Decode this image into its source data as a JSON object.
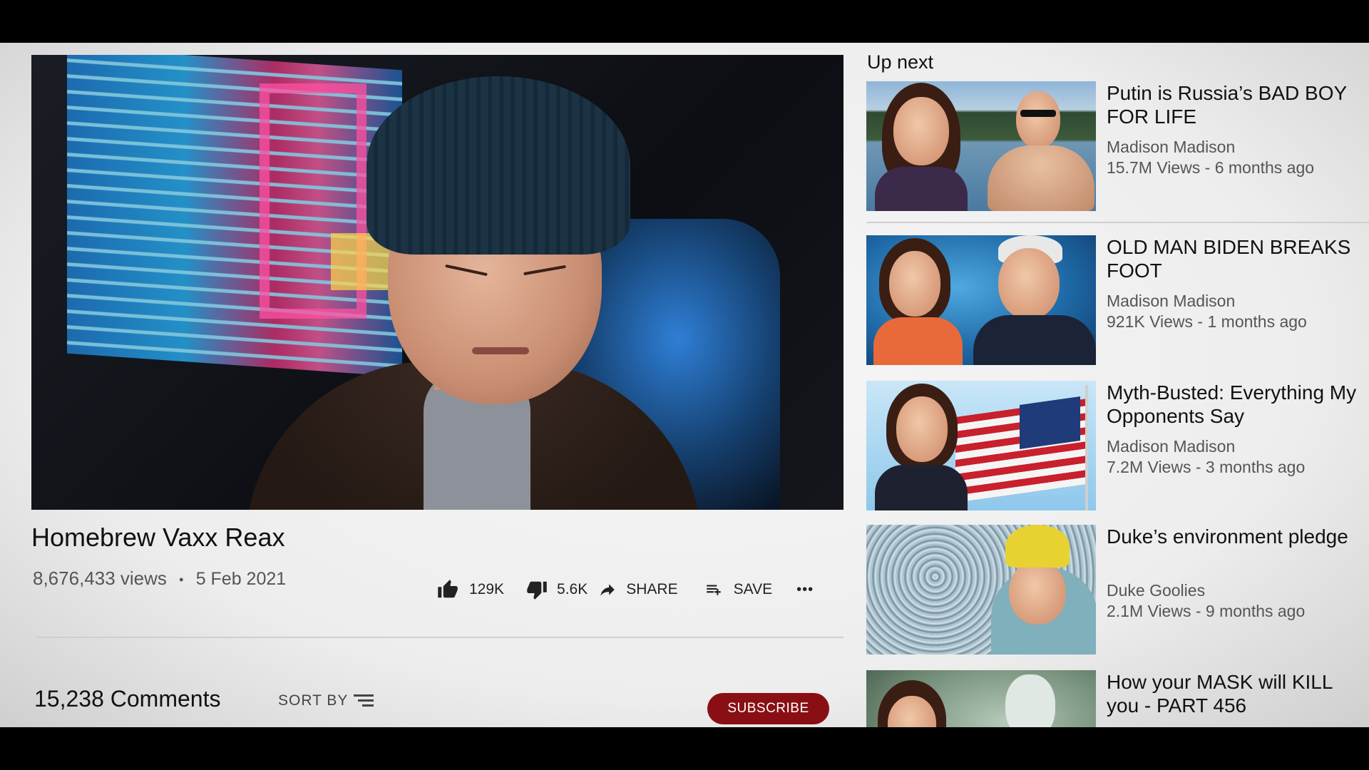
{
  "video": {
    "title": "Homebrew Vaxx Reax",
    "views": "8,676,433 views",
    "separator": "•",
    "date": "5 Feb 2021"
  },
  "actions": {
    "likes": "129K",
    "dislikes": "5.6K",
    "share": "SHARE",
    "save": "SAVE",
    "more": "•••"
  },
  "comments": {
    "count": "15,238 Comments",
    "sort_label": "SORT BY"
  },
  "subscribe": {
    "label": "SUBSCRIBE"
  },
  "up_next": {
    "heading": "Up next",
    "items": [
      {
        "title": "Putin is Russia’s BAD BOY FOR LIFE",
        "channel": "Madison Madison",
        "meta": "15.7M Views - 6 months ago"
      },
      {
        "title": "OLD MAN BIDEN BREAKS FOOT",
        "channel": "Madison Madison",
        "meta": "921K Views - 1 months ago"
      },
      {
        "title": "Myth-Busted: Everything My Opponents Say",
        "channel": "Madison Madison",
        "meta": "7.2M Views - 3 months ago"
      },
      {
        "title": "Duke’s environment pledge",
        "channel": "Duke Goolies",
        "meta": "2.1M Views - 9 months ago"
      },
      {
        "title": "How your MASK will KILL you - PART 456",
        "channel": "",
        "meta": ""
      }
    ]
  },
  "colors": {
    "subscribe_bg": "#8a0f14",
    "page_bg": "#efefef",
    "letterbox": "#000000"
  },
  "icons": [
    "thumb-up-icon",
    "thumb-down-icon",
    "share-arrow-icon",
    "playlist-add-icon",
    "more-dots-icon",
    "sort-lines-icon"
  ]
}
